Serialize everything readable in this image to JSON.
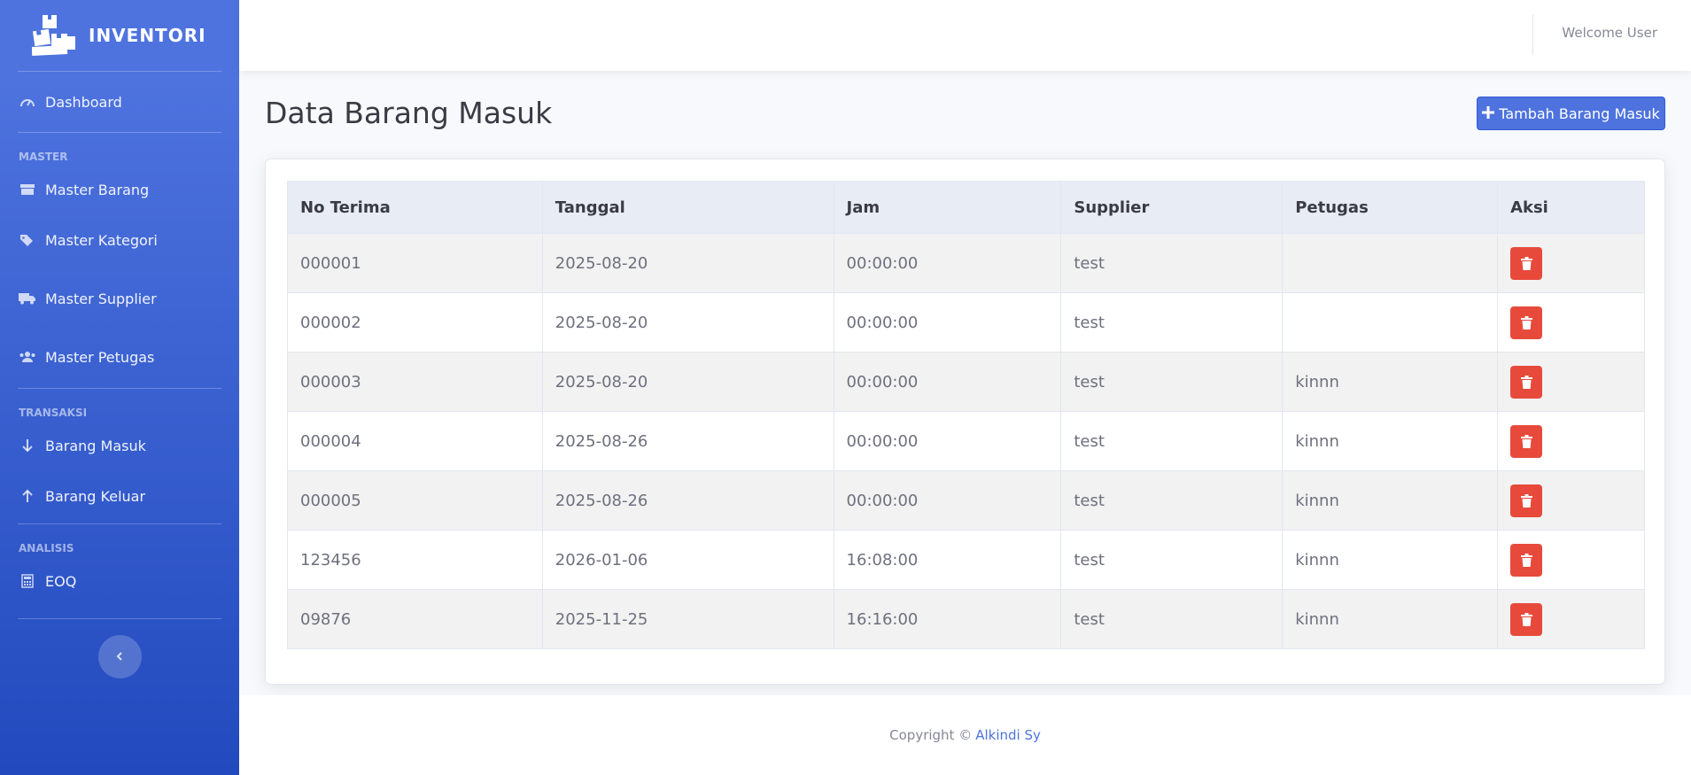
{
  "brand": {
    "name": "INVENTORI",
    "icon": "boxes-icon"
  },
  "sidebar": {
    "dashboard": {
      "label": "Dashboard",
      "icon": "tachometer-icon"
    },
    "headings": {
      "master": "MASTER",
      "transaksi": "TRANSAKSI",
      "analisis": "ANALISIS"
    },
    "master": [
      {
        "label": "Master Barang",
        "icon": "box-icon"
      },
      {
        "label": "Master Kategori",
        "icon": "tags-icon"
      },
      {
        "label": "Master Supplier",
        "icon": "truck-icon"
      },
      {
        "label": "Master Petugas",
        "icon": "users-icon"
      }
    ],
    "transaksi": [
      {
        "label": "Barang Masuk",
        "icon": "arrow-down-icon"
      },
      {
        "label": "Barang Keluar",
        "icon": "arrow-up-icon"
      }
    ],
    "analisis": [
      {
        "label": "EOQ",
        "icon": "calculator-icon"
      }
    ],
    "toggle_icon": "chevron-left-icon"
  },
  "topbar": {
    "welcome": "Welcome User"
  },
  "page": {
    "title": "Data Barang Masuk",
    "add_button": "Tambah Barang Masuk"
  },
  "table": {
    "columns": [
      "No Terima",
      "Tanggal",
      "Jam",
      "Supplier",
      "Petugas",
      "Aksi"
    ],
    "rows": [
      [
        "000001",
        "2025-08-20",
        "00:00:00",
        "test",
        ""
      ],
      [
        "000002",
        "2025-08-20",
        "00:00:00",
        "test",
        ""
      ],
      [
        "000003",
        "2025-08-20",
        "00:00:00",
        "test",
        "kinnn"
      ],
      [
        "000004",
        "2025-08-26",
        "00:00:00",
        "test",
        "kinnn"
      ],
      [
        "000005",
        "2025-08-26",
        "00:00:00",
        "test",
        "kinnn"
      ],
      [
        "123456",
        "2026-01-06",
        "16:08:00",
        "test",
        "kinnn"
      ],
      [
        "09876",
        "2025-11-25",
        "16:16:00",
        "test",
        "kinnn"
      ]
    ],
    "action_icon": "trash-icon"
  },
  "footer": {
    "text": "Copyright ©",
    "author": "Alkindi Sy"
  },
  "colors": {
    "primary": "#4e73df",
    "danger": "#e74a3b",
    "sidebar_end": "#224abe"
  }
}
